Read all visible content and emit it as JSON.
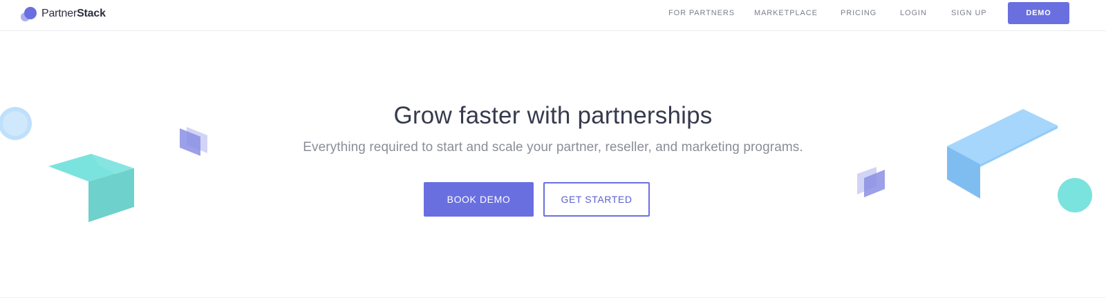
{
  "brand": {
    "name_part1": "Partner",
    "name_part2": "Stack"
  },
  "nav": {
    "items": [
      {
        "label": "FOR PARTNERS"
      },
      {
        "label": "MARKETPLACE"
      },
      {
        "label": "PRICING"
      },
      {
        "label": "LOGIN"
      },
      {
        "label": "SIGN UP"
      }
    ],
    "demo_label": "DEMO"
  },
  "hero": {
    "title": "Grow faster with partnerships",
    "subtitle": "Everything required to start and scale your partner, reseller, and marketing programs.",
    "primary_cta": "BOOK DEMO",
    "secondary_cta": "GET STARTED"
  },
  "colors": {
    "brand_primary": "#6a6fe0",
    "teal": "#74e0dc",
    "sky": "#a6d6fb"
  },
  "icons": {
    "logo": "partnerstack-logo-icon"
  }
}
